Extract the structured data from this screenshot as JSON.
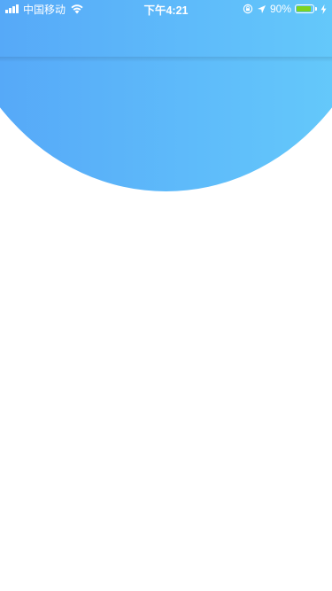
{
  "status_bar": {
    "carrier": "中国移动",
    "time": "下午4:21",
    "battery_percent_label": "90%",
    "battery_level": 0.9,
    "icons": [
      "signal-icon",
      "wifi-icon",
      "orientation-lock-icon",
      "location-icon",
      "battery-icon",
      "charging-icon"
    ]
  },
  "colors": {
    "header_gradient_start": "#54a4f8",
    "header_gradient_end": "#66cdfb",
    "battery_fill": "#7ed321",
    "background": "#ffffff"
  }
}
